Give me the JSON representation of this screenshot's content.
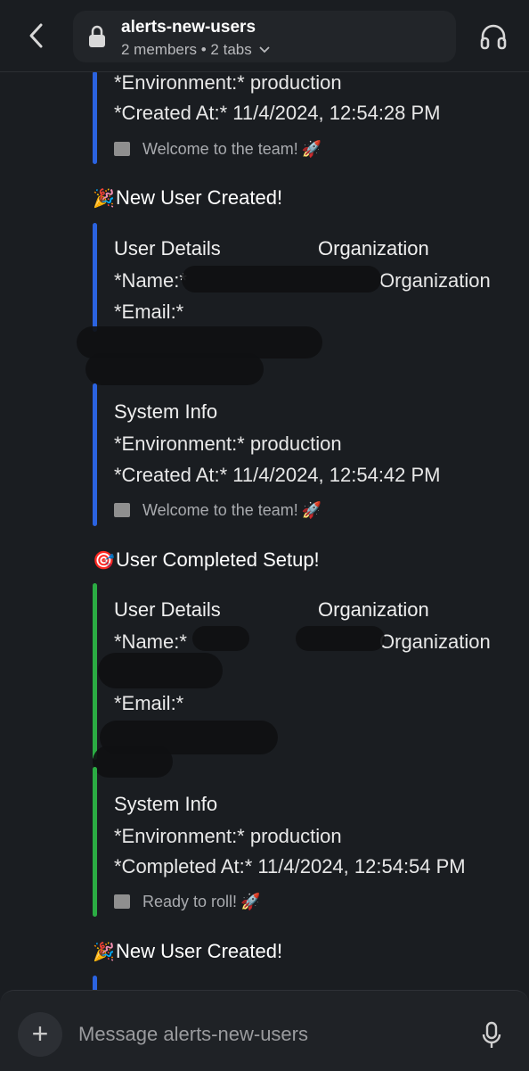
{
  "header": {
    "channel_name": "alerts-new-users",
    "subtitle": "2 members • 2 tabs"
  },
  "messages": [
    {
      "environment_line": "*Environment:* production",
      "created_line": "*Created At:* 11/4/2024, 12:54:28 PM",
      "footer": "Welcome to the team!"
    },
    {
      "title": "New User Created!",
      "user_details_label": "User Details",
      "organization_label": "Organization",
      "name_label": "*Name:*",
      "name_org_value": "Organization",
      "email_label": "*Email:*",
      "system_info_label": "System Info",
      "environment_line": "*Environment:* production",
      "created_line": "*Created At:* 11/4/2024, 12:54:42 PM",
      "footer": "Welcome to the team!"
    },
    {
      "title": "User Completed Setup!",
      "user_details_label": "User Details",
      "organization_label": "Organization",
      "name_label": "*Name:*",
      "name_org_value": "Organization",
      "email_label": "*Email:*",
      "system_info_label": "System Info",
      "environment_line": "*Environment:* production",
      "completed_line": "*Completed At:* 11/4/2024, 12:54:54 PM",
      "footer": "Ready to roll!"
    },
    {
      "title": "New User Created!"
    }
  ],
  "composer": {
    "placeholder": "Message alerts-new-users"
  },
  "colors": {
    "background": "#1a1d21",
    "accent_blue": "#2b63e0",
    "accent_green": "#2bac43"
  },
  "icons": [
    "back-icon",
    "lock-icon",
    "chevron-down-icon",
    "headphones-icon",
    "party-popper-icon",
    "target-icon",
    "box-icon",
    "rocket-icon",
    "plus-icon",
    "microphone-icon"
  ]
}
